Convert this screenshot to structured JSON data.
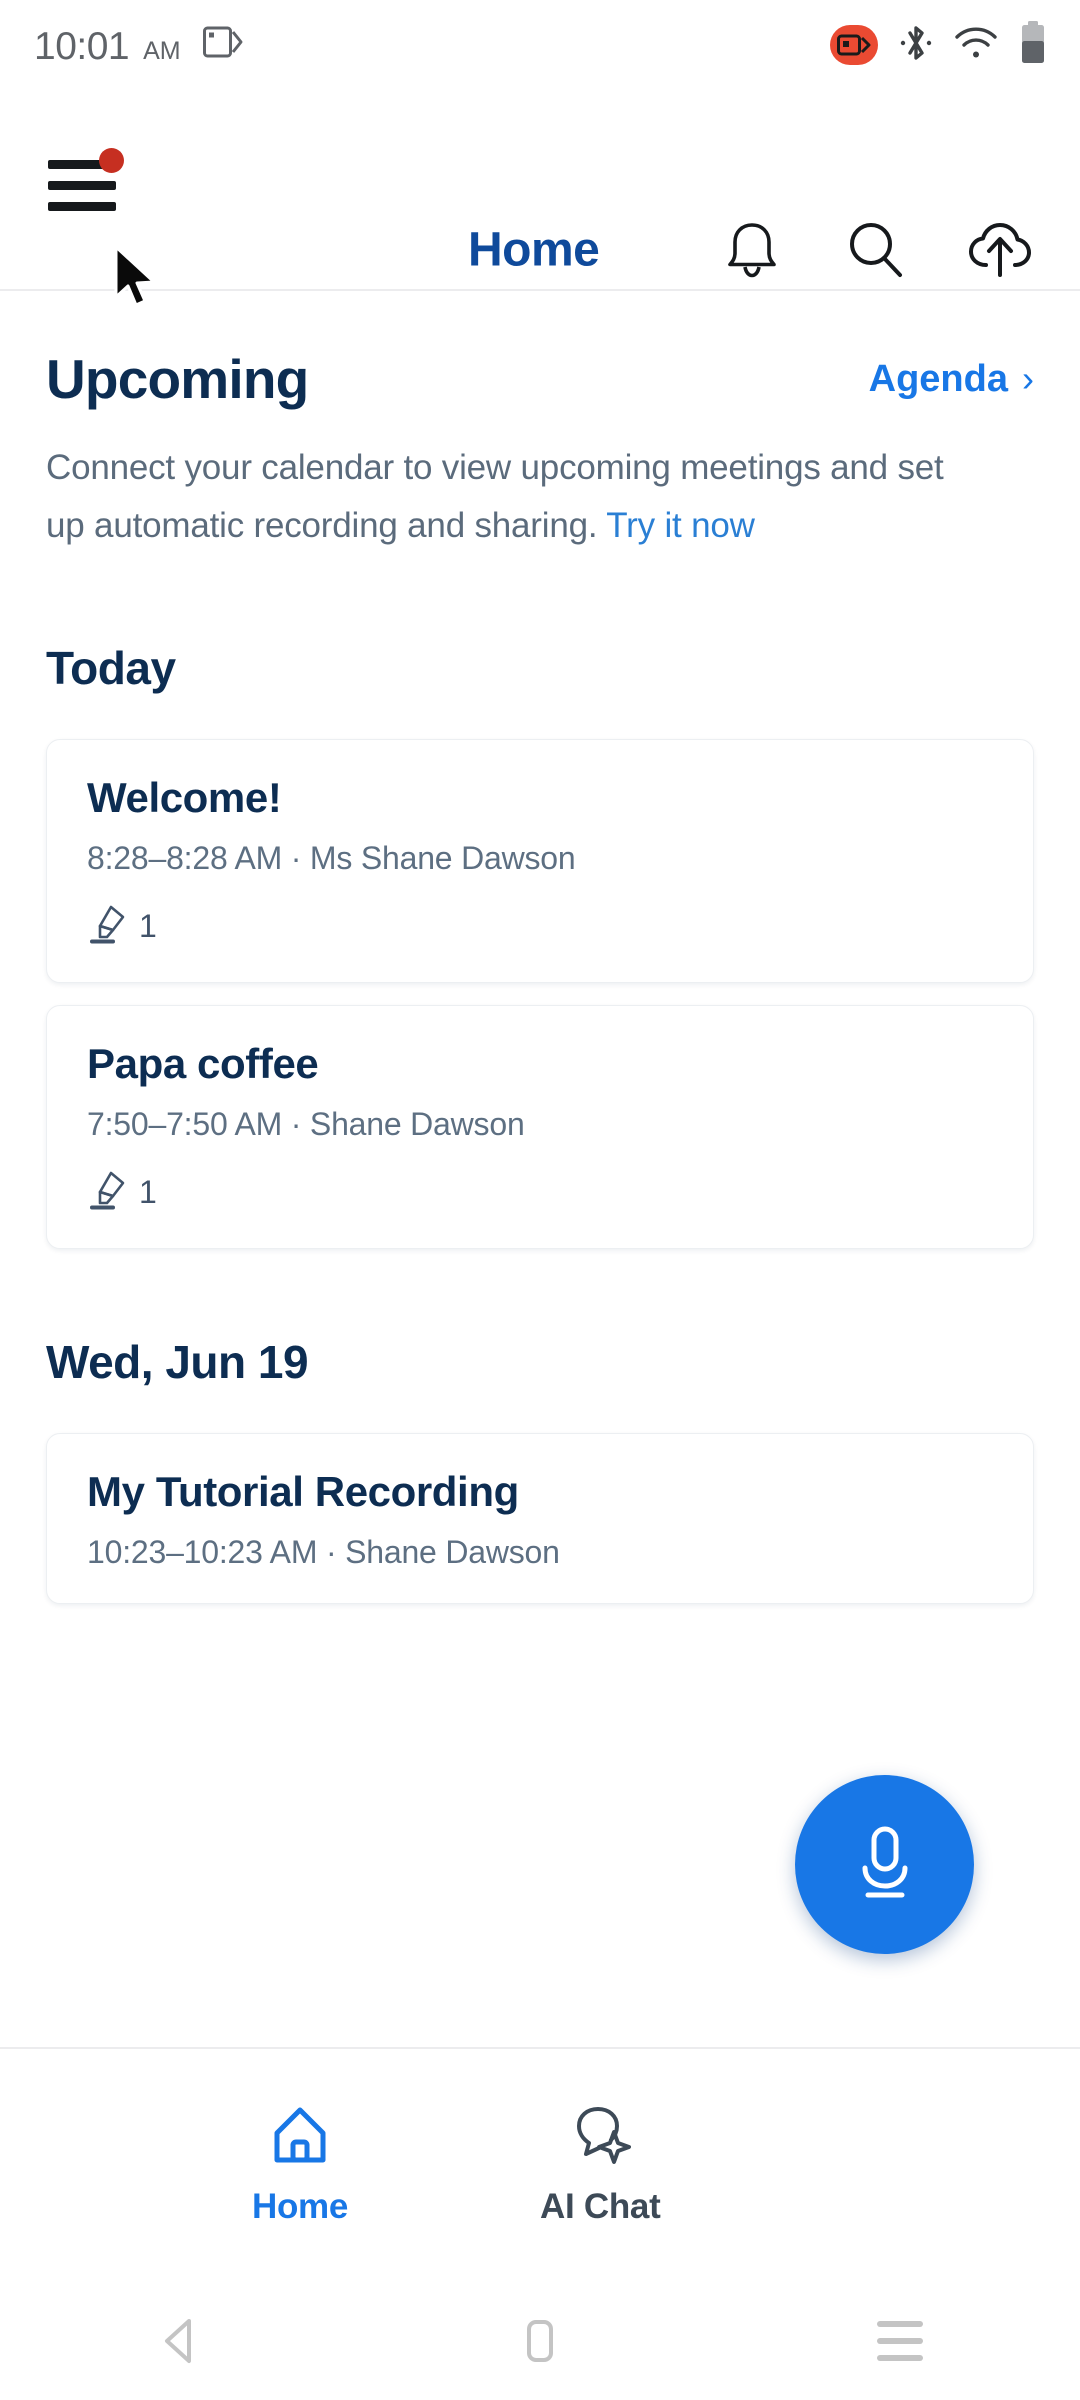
{
  "status_bar": {
    "time": "10:01",
    "ampm": "AM",
    "icons": [
      "cast-icon",
      "screen-record-icon",
      "bluetooth-icon",
      "wifi-icon",
      "battery-icon"
    ]
  },
  "header": {
    "menu_icon": "hamburger-menu-icon",
    "has_notification_dot": true,
    "title": "Home",
    "actions": [
      "bell-icon",
      "search-icon",
      "cloud-upload-icon"
    ]
  },
  "upcoming": {
    "heading": "Upcoming",
    "agenda_label": "Agenda",
    "agenda_chevron": "›",
    "blurb_text": "Connect your calendar to view upcoming meetings and set up automatic recording and sharing. ",
    "blurb_link": "Try it now"
  },
  "sections": [
    {
      "heading": "Today",
      "cards": [
        {
          "title": "Welcome!",
          "subtitle": "8:28–8:28 AM ·  Ms Shane Dawson",
          "meta_icon": "highlighter-icon",
          "meta_count": "1"
        },
        {
          "title": "Papa coffee",
          "subtitle": "7:50–7:50 AM ·  Shane Dawson",
          "meta_icon": "highlighter-icon",
          "meta_count": "1"
        }
      ]
    },
    {
      "heading": "Wed, Jun 19",
      "cards": [
        {
          "title": "My Tutorial Recording",
          "subtitle": "10:23–10:23 AM ·  Shane Dawson",
          "meta_icon": null,
          "meta_count": null
        }
      ]
    }
  ],
  "fab": {
    "icon": "microphone-icon",
    "color": "#1877e6"
  },
  "bottom_nav": {
    "items": [
      {
        "label": "Home",
        "icon": "home-icon",
        "active": true
      },
      {
        "label": "AI Chat",
        "icon": "chat-sparkle-icon",
        "active": false
      }
    ]
  },
  "android_nav": {
    "back": "back-triangle-icon",
    "home": "home-square-icon",
    "recents": "recents-lines-icon"
  },
  "colors": {
    "accent_blue": "#1877e6",
    "title_navy": "#0d2d52",
    "muted_text": "#5d6f82",
    "record_red": "#ea4a32",
    "badge_red": "#c62f21"
  }
}
